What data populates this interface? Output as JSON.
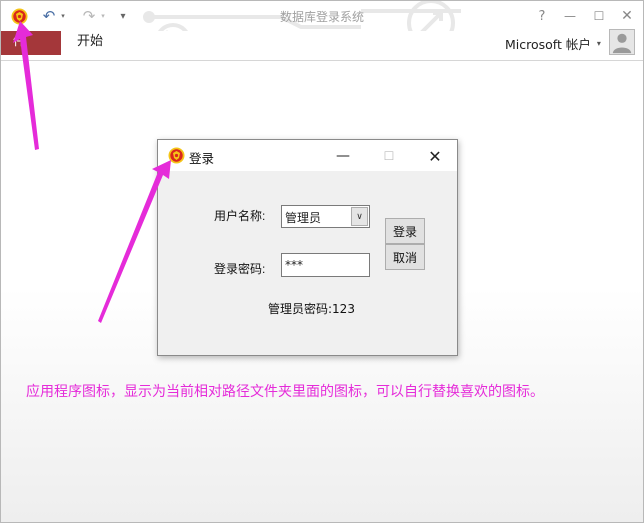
{
  "app": {
    "title": "数据库登录系统",
    "qat": {
      "undo_icon": "↶",
      "redo_icon": "↷",
      "dropdown_icon": "▾",
      "customize_icon": "▾"
    },
    "window_controls": {
      "help": "?",
      "minimize": "—",
      "maximize": "☐",
      "close": "✕"
    }
  },
  "ribbon": {
    "tabs": [
      {
        "label": "件"
      },
      {
        "label": "开始"
      }
    ],
    "account_label": "Microsoft 帐户",
    "account_dropdown": "▾"
  },
  "dialog": {
    "title": "登录",
    "controls": {
      "minimize": "—",
      "maximize": "☐",
      "close": "✕"
    },
    "username_label": "用户名称:",
    "username_value": "管理员",
    "username_arrow": "∨",
    "password_label": "登录密码:",
    "password_value": "***",
    "login_button": "登录",
    "cancel_button": "取消",
    "hint": "管理员密码:123"
  },
  "annotation": {
    "text": "应用程序图标，显示为当前相对路径文件夹里面的图标，可以自行替换喜欢的图标。",
    "color": "#e52bd9"
  },
  "colors": {
    "file_tab": "#a4373a",
    "annotation": "#e52bd9"
  },
  "icons": {
    "app_icon": "club-crest-icon",
    "dialog_icon": "club-crest-icon"
  }
}
